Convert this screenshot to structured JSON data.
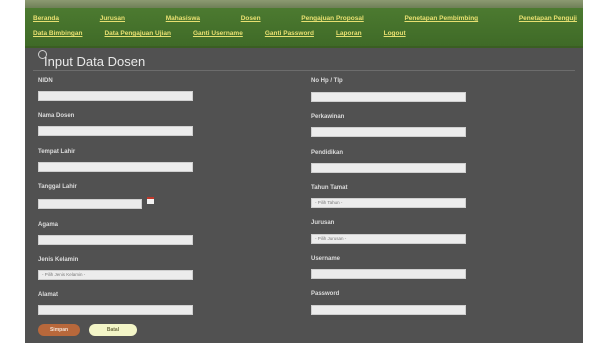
{
  "nav": {
    "row1": [
      "Beranda",
      "Jurusan",
      "Mahasiswa",
      "Dosen",
      "Pengajuan Proposal",
      "Penetapan Pembimbing",
      "Penetapan Penguji"
    ],
    "row2": [
      "Data Bimbingan",
      "Data Pengajuan Ujian",
      "Ganti Username",
      "Ganti Password",
      "Laporan",
      "Logout"
    ]
  },
  "page": {
    "title": "Input Data Dosen"
  },
  "form": {
    "nidn_label": "NIDN",
    "nama_label": "Nama Dosen",
    "tempat_lahir_label": "Tempat Lahir",
    "tanggal_lahir_label": "Tanggal Lahir",
    "agama_label": "Agama",
    "jenis_kelamin_label": "Jenis Kelamin",
    "jenis_kelamin_placeholder": "- Pilih Jenis Kelamin -",
    "alamat_label": "Alamat",
    "no_hp_label": "No Hp / Tlp",
    "perkawinan_label": "Perkawinan",
    "pendidikan_label": "Pendidikan",
    "tahun_tamat_label": "Tahun Tamat",
    "tahun_placeholder": "- Pilih Tahun -",
    "jurusan_label": "Jurusan",
    "jurusan_placeholder": "- Pilih Jurusan -",
    "username_label": "Username",
    "password_label": "Password"
  },
  "buttons": {
    "save": "Simpan",
    "cancel": "Batal"
  },
  "colors": {
    "nav_bg": "#46722b",
    "nav_link": "#e8e071",
    "panel_bg": "#515151",
    "save_btn": "#b8683b",
    "cancel_btn": "#f4f6c8"
  }
}
